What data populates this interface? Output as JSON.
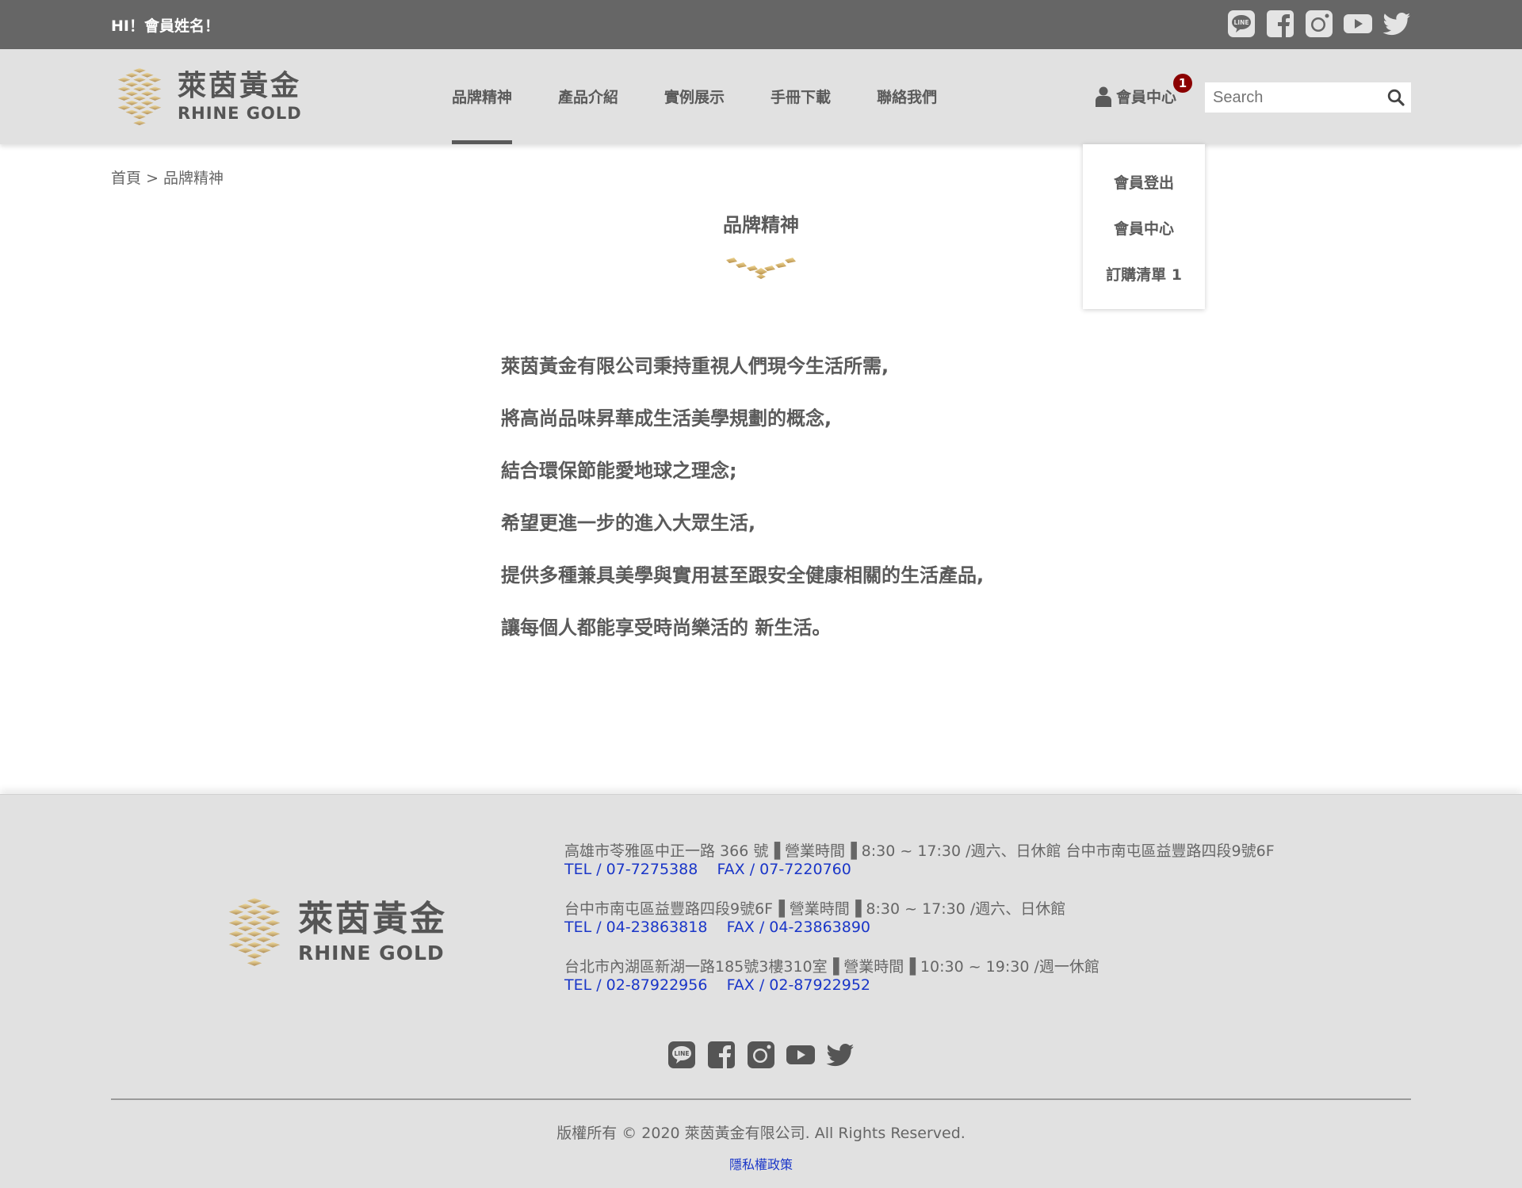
{
  "topbar": {
    "greeting": "HI！會員姓名！",
    "social": [
      {
        "icon": "line-icon"
      },
      {
        "icon": "facebook-icon"
      },
      {
        "icon": "instagram-icon"
      },
      {
        "icon": "youtube-icon"
      },
      {
        "icon": "twitter-icon"
      }
    ]
  },
  "brand": {
    "name_zh": "萊茵黃金",
    "name_en": "RHINE GOLD",
    "gold_light": "#f0dca0",
    "gold_dark": "#b4925a"
  },
  "nav": {
    "items": [
      "品牌精神",
      "產品介紹",
      "實例展示",
      "手冊下載",
      "聯絡我們"
    ],
    "active": "品牌精神"
  },
  "member": {
    "label": "會員中心",
    "badge": "1",
    "dropdown": [
      "會員登出",
      "會員中心",
      "訂購清單 1"
    ]
  },
  "search": {
    "placeholder": "Search",
    "value": ""
  },
  "breadcrumb": {
    "home": "首頁",
    "separator": ">",
    "current": "品牌精神"
  },
  "page": {
    "title": "品牌精神",
    "paragraphs": [
      "萊茵黃金有限公司秉持重視人們現今生活所需,",
      "將高尚品味昇華成生活美學規劃的概念,",
      "結合環保節能愛地球之理念;",
      "希望更進一步的進入大眾生活,",
      "提供多種兼具美學與實用甚至跟安全健康相關的生活產品,",
      "讓每個人都能享受時尚樂活的 新生活。"
    ]
  },
  "footer": {
    "branches": [
      {
        "address": "高雄市苓雅區中正一路 366 號▐ 營業時間▐  8:30 ~ 17:30 /週六、日休館 台中市南屯區益豐路四段9號6F",
        "tel": "TEL / 07-7275388",
        "fax": "FAX / 07-7220760"
      },
      {
        "address": "台中市南屯區益豐路四段9號6F▐ 營業時間▐  8:30 ~ 17:30 /週六、日休館",
        "tel": "TEL / 04-23863818",
        "fax": "FAX / 04-23863890"
      },
      {
        "address": "台北市內湖區新湖一路185號3樓310室▐ 營業時間▐  10:30 ~ 19:30 /週一休館",
        "tel": "TEL / 02-87922956",
        "fax": "FAX / 02-87922952"
      }
    ],
    "copyright": "版權所有 © 2020   萊茵黃金有限公司.   All Rights Reserved.",
    "privacy": "隱私權政策"
  },
  "colors": {
    "topbar_bg": "#666666",
    "header_bg": "#e1e1e1",
    "text": "#5a5a5a",
    "badge": "#8b0000",
    "link": "#1a36c8"
  }
}
